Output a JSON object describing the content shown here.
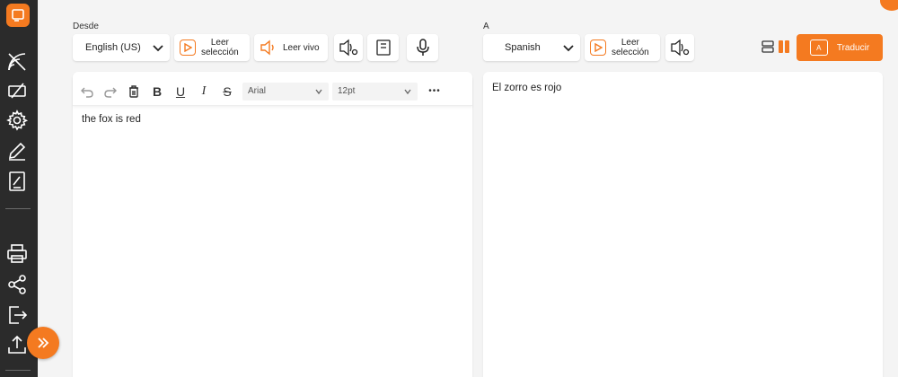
{
  "sidebar": {
    "items": [
      {
        "icon": "logo-icon"
      },
      {
        "icon": "no-signal-icon"
      },
      {
        "icon": "eraser-icon"
      },
      {
        "icon": "settings-gear-icon"
      },
      {
        "icon": "pencil-icon"
      },
      {
        "icon": "document-edit-icon"
      },
      {
        "icon": "print-icon"
      },
      {
        "icon": "share-icon"
      },
      {
        "icon": "exit-icon"
      },
      {
        "icon": "upload-icon"
      }
    ],
    "expand_glyph": "»"
  },
  "source": {
    "label": "Desde",
    "language": "English (US)",
    "read_selection": [
      "Leer",
      "selección"
    ],
    "read_live": "Leer vivo",
    "font": "Arial",
    "size": "12pt",
    "more": "•••",
    "text": "the fox is red"
  },
  "target": {
    "label": "A",
    "language": "Spanish",
    "read_selection": [
      "Leer",
      "selección"
    ],
    "translate": "Traducir",
    "text": "El zorro es rojo"
  },
  "colors": {
    "accent": "#f47a20",
    "sidebar": "#2b2b2b"
  }
}
